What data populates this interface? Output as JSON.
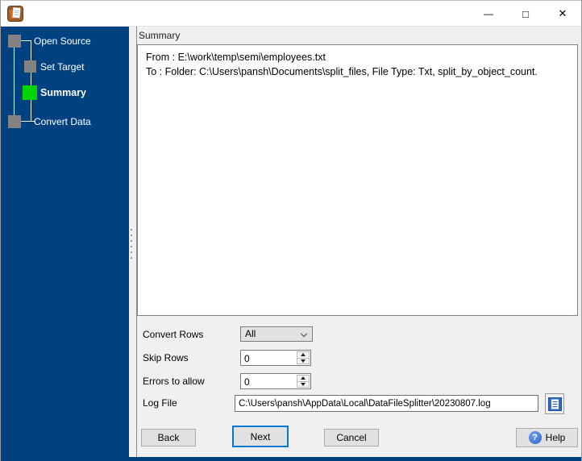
{
  "window": {
    "controls": {
      "minimize": "—",
      "maximize": "□",
      "close": "✕"
    }
  },
  "colors": {
    "sidebar_bg": "#004280",
    "step_active": "#00d500",
    "step_inactive": "#838383",
    "focus_border": "#0078d7",
    "help_icon_bg": "#2d62c8"
  },
  "sidebar": {
    "steps": [
      {
        "label": "Open Source"
      },
      {
        "label": "Set Target"
      },
      {
        "label": "Summary"
      },
      {
        "label": "Convert Data"
      }
    ]
  },
  "main": {
    "caption": "Summary",
    "summary_lines": [
      "From : E:\\work\\temp\\semi\\employees.txt",
      "To : Folder: C:\\Users\\pansh\\Documents\\split_files, File Type: Txt, split_by_object_count."
    ],
    "fields": {
      "convert_rows": {
        "label": "Convert Rows",
        "value": "All"
      },
      "skip_rows": {
        "label": "Skip Rows",
        "value": "0"
      },
      "errors_to_allow": {
        "label": "Errors to allow",
        "value": "0"
      },
      "log_file": {
        "label": "Log File",
        "value": "C:\\Users\\pansh\\AppData\\Local\\DataFileSplitter\\20230807.log"
      }
    },
    "buttons": {
      "back": "Back",
      "next": "Next",
      "cancel": "Cancel",
      "help": "Help"
    },
    "icons": {
      "help_glyph": "?"
    }
  }
}
